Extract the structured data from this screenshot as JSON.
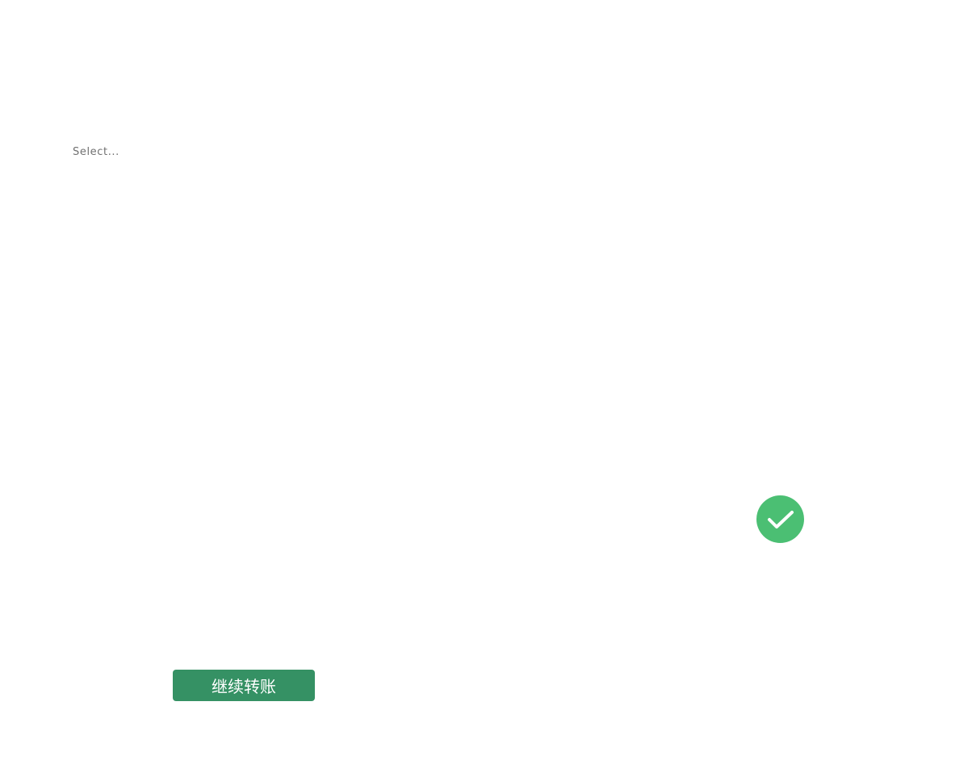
{
  "select": {
    "placeholder": "Select..."
  },
  "status": {
    "icon": "checkmark-circle-icon",
    "color": "#4bbf73",
    "state": "success"
  },
  "actions": {
    "continue_transfer_label": "继续转账",
    "continue_transfer_color": "#359164"
  }
}
